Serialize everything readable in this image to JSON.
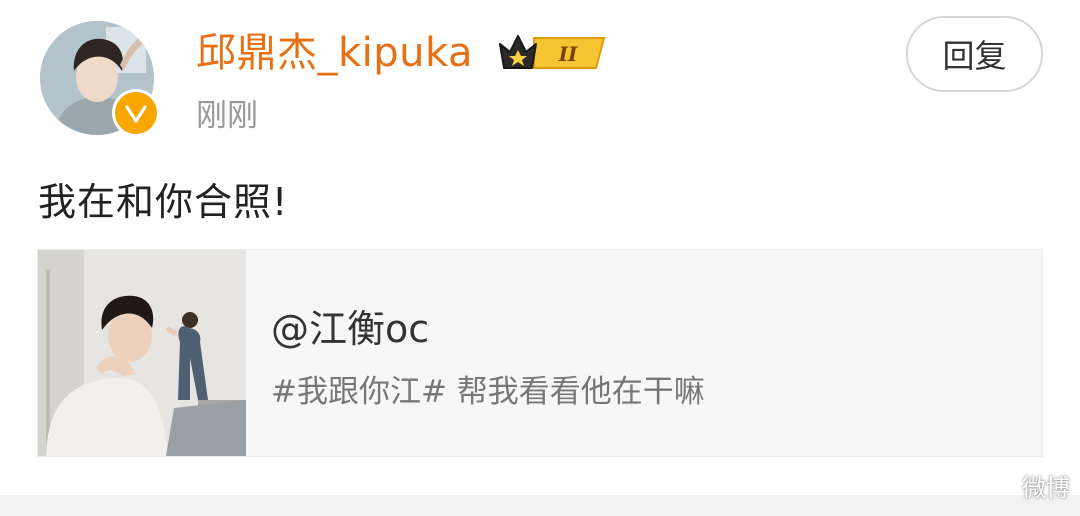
{
  "post": {
    "author": {
      "name": "邱鼎杰_kipuka",
      "badge_level": "II"
    },
    "time": "刚刚",
    "reply_label": "回复",
    "text": "我在和你合照!",
    "shared_card": {
      "title": "@江衡oc",
      "description": "#我跟你江# 帮我看看他在干嘛"
    }
  },
  "watermark": "微博",
  "colors": {
    "username": "#e86f12",
    "verified_badge": "#f8a600",
    "vip_badge": "#f5c531",
    "card_background": "#f7f7f7"
  }
}
